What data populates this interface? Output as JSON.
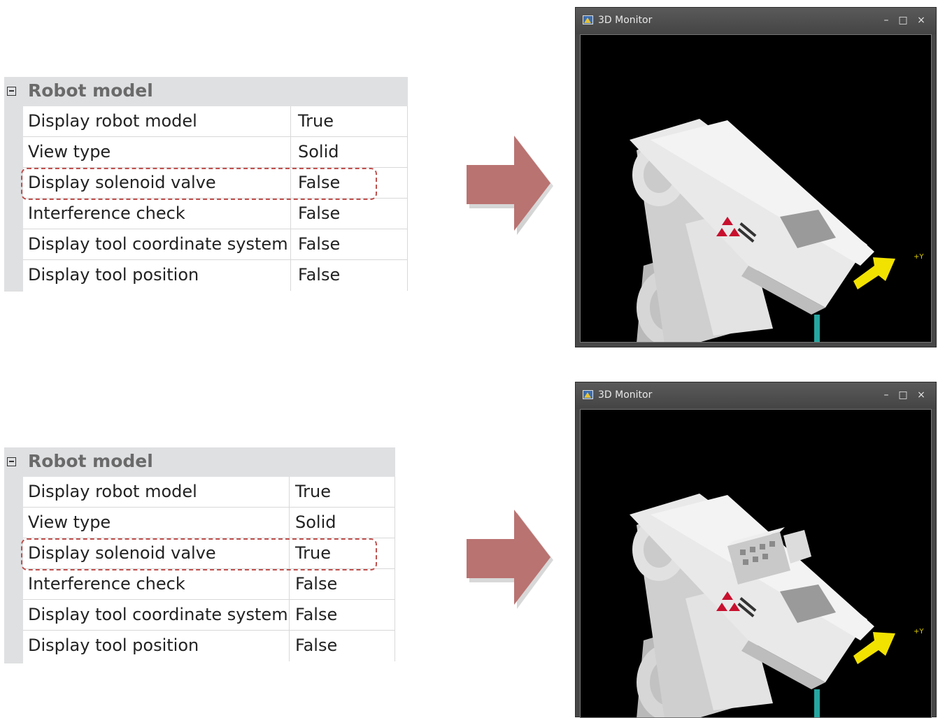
{
  "panels": [
    {
      "header": "Robot model",
      "rows": [
        {
          "name": "Display robot model",
          "value": "True"
        },
        {
          "name": "View type",
          "value": "Solid"
        },
        {
          "name": "Display solenoid valve",
          "value": "False"
        },
        {
          "name": "Interference check",
          "value": "False"
        },
        {
          "name": "Display tool coordinate system",
          "value": "False"
        },
        {
          "name": "Display tool position",
          "value": "False"
        }
      ],
      "monitor": {
        "title": "3D Monitor",
        "axis_label": "+Y",
        "solenoid_valve_shown": false
      }
    },
    {
      "header": "Robot model",
      "rows": [
        {
          "name": "Display robot model",
          "value": "True"
        },
        {
          "name": "View type",
          "value": "Solid"
        },
        {
          "name": "Display solenoid valve",
          "value": "True"
        },
        {
          "name": "Interference check",
          "value": "False"
        },
        {
          "name": "Display tool coordinate system",
          "value": "False"
        },
        {
          "name": "Display tool position",
          "value": "False"
        }
      ],
      "monitor": {
        "title": "3D Monitor",
        "axis_label": "+Y",
        "solenoid_valve_shown": true
      }
    }
  ],
  "window_controls": {
    "minimize": "–",
    "maximize": "□",
    "close": "×"
  },
  "colors": {
    "highlight": "#c0504d",
    "arrow": "#b97371",
    "header_bg": "#dfe0e2",
    "viewport_bg": "#000000",
    "tool_axis": "#f2e200",
    "cable": "#26a6a0"
  },
  "icons": [
    "collapse-icon",
    "window-app-icon",
    "minimize-icon",
    "maximize-icon",
    "close-icon",
    "right-arrow-icon"
  ]
}
